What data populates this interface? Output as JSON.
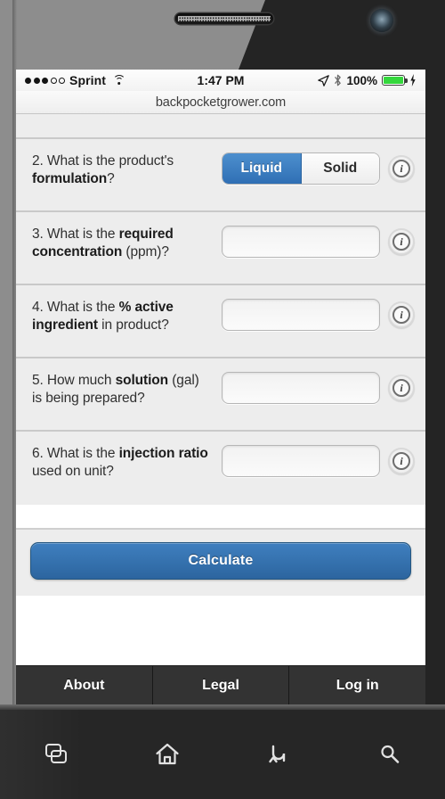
{
  "device": {
    "speaker_icon": "speaker-grille",
    "camera_icon": "front-camera"
  },
  "status_bar": {
    "signal_dots_filled": 3,
    "signal_dots_total": 5,
    "carrier": "Sprint",
    "wifi_icon": "wifi-icon",
    "time": "1:47 PM",
    "location_icon": "location-arrow-icon",
    "bluetooth_icon": "bluetooth-icon",
    "battery_percent": "100%",
    "battery_icon": "battery-icon",
    "charging_icon": "charging-bolt-icon",
    "battery_color": "#34d73c"
  },
  "browser": {
    "url": "backpocketgrower.com"
  },
  "form": {
    "questions": [
      {
        "id": "q2",
        "number": "2.",
        "text_parts": [
          {
            "text": "2. What is the product's ",
            "bold": false
          },
          {
            "text": "formulation",
            "bold": true
          },
          {
            "text": "?",
            "bold": false
          }
        ],
        "control": "segmented",
        "options": [
          "Liquid",
          "Solid"
        ],
        "selected": "Liquid",
        "value": "",
        "info_icon": "info-icon"
      },
      {
        "id": "q3",
        "number": "3.",
        "text_parts": [
          {
            "text": "3. What is the ",
            "bold": false
          },
          {
            "text": "required concentration",
            "bold": true
          },
          {
            "text": " (ppm)?",
            "bold": false
          }
        ],
        "control": "input",
        "value": "",
        "placeholder": "",
        "info_icon": "info-icon"
      },
      {
        "id": "q4",
        "number": "4.",
        "text_parts": [
          {
            "text": "4. What is the ",
            "bold": false
          },
          {
            "text": "% active ingredient",
            "bold": true
          },
          {
            "text": " in product?",
            "bold": false
          }
        ],
        "control": "input",
        "value": "",
        "placeholder": "",
        "info_icon": "info-icon"
      },
      {
        "id": "q5",
        "number": "5.",
        "text_parts": [
          {
            "text": "5. How much ",
            "bold": false
          },
          {
            "text": "solution",
            "bold": true
          },
          {
            "text": " (gal) is being prepared?",
            "bold": false
          }
        ],
        "control": "input",
        "value": "",
        "placeholder": "",
        "info_icon": "info-icon"
      },
      {
        "id": "q6",
        "number": "6.",
        "text_parts": [
          {
            "text": "6. What is the ",
            "bold": false
          },
          {
            "text": "injection ratio",
            "bold": true
          },
          {
            "text": " used on unit?",
            "bold": false
          }
        ],
        "control": "input",
        "value": "",
        "placeholder": "",
        "info_icon": "info-icon"
      }
    ],
    "calculate_label": "Calculate",
    "accent_color": "#2f6fb4"
  },
  "footer": {
    "tabs": [
      {
        "label": "About"
      },
      {
        "label": "Legal"
      },
      {
        "label": "Log in"
      }
    ]
  },
  "nav_bar": {
    "buttons": [
      {
        "icon": "recent-apps-icon"
      },
      {
        "icon": "home-icon"
      },
      {
        "icon": "back-icon"
      },
      {
        "icon": "search-icon"
      }
    ]
  }
}
